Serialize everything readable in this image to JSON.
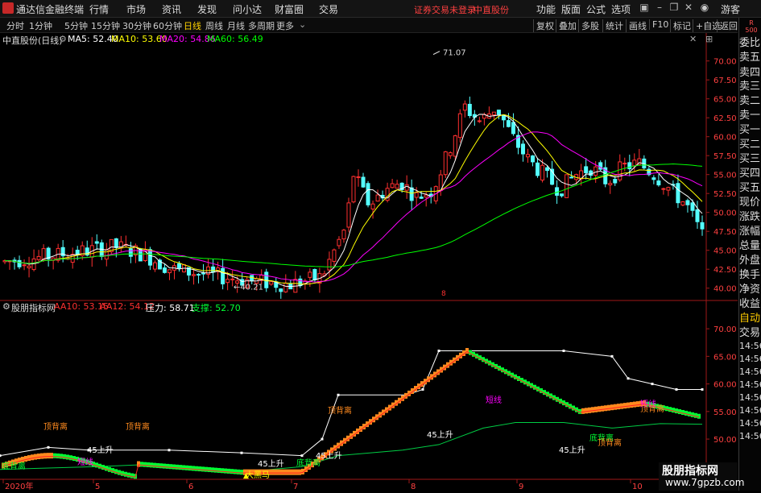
{
  "app": {
    "title": "通达信金融终端",
    "notice": "证券交易未登录",
    "stock_header": "中直股份",
    "guest": "游客"
  },
  "main_menu": [
    "行情",
    "市场",
    "资讯",
    "发现",
    "问小达",
    "财富圈",
    "交易"
  ],
  "right_menu": [
    "功能",
    "版面",
    "公式",
    "选项"
  ],
  "periods": [
    "分时",
    "1分钟",
    "5分钟",
    "15分钟",
    "30分钟",
    "60分钟",
    "日线",
    "周线",
    "月线",
    "多周期",
    "更多"
  ],
  "active_period": "日线",
  "tools": [
    "复权",
    "叠加",
    "多股",
    "统计",
    "画线",
    "F10",
    "标记",
    "+自选",
    "返回"
  ],
  "side_panel": {
    "badge": "R\n500",
    "items": [
      "委比",
      "卖五",
      "卖四",
      "卖三",
      "卖二",
      "卖一",
      "买一",
      "买二",
      "买三",
      "买四",
      "买五",
      "现价",
      "涨跌",
      "涨幅",
      "总量",
      "外盘",
      "换手",
      "净资",
      "收益",
      "自动",
      "交易",
      "14:56",
      "14:56",
      "14:56",
      "14:56",
      "14:56",
      "14:56",
      "14:56",
      "14:56"
    ]
  },
  "main_legend": {
    "stock": "中直股份(日线)",
    "ma5": "MA5: 52.40",
    "ma10": "MA10: 53.60",
    "ma20": "MA20: 54.86",
    "ma60": "MA60: 56.49"
  },
  "indicator_legend": {
    "name": "股朋指标网",
    "aa10": "AA10: 53.15",
    "aa12": "AA12: 54.12",
    "pressure": "压力: 58.71",
    "support": "支撑: 52.70"
  },
  "colors": {
    "up": "#ff3030",
    "down": "#54ffff",
    "ma5": "#ffffff",
    "ma10": "#ffff00",
    "ma20": "#ff00ff",
    "ma60": "#00ff00",
    "bull_bar": "#ff8a1e",
    "bear_bar": "#00ff33"
  },
  "annotations": {
    "high": "71.07",
    "low": "40.21",
    "mid_marker": "8"
  },
  "indicator_labels": [
    {
      "text": "底背离",
      "color": "#00ff33"
    },
    {
      "text": "顶背离",
      "color": "#ff8a1e"
    },
    {
      "text": "45上升",
      "color": "#ffffff"
    },
    {
      "text": "短线",
      "color": "#ff00ff"
    },
    {
      "text": "顶背离",
      "color": "#ff8a1e"
    },
    {
      "text": "45上升",
      "color": "#ffffff"
    },
    {
      "text": "大黑马",
      "color": "#ffff00"
    },
    {
      "text": "底背离",
      "color": "#00ff33"
    },
    {
      "text": "45上升",
      "color": "#ffffff"
    },
    {
      "text": "顶背离",
      "color": "#ff8a1e"
    },
    {
      "text": "45上升",
      "color": "#ffffff"
    },
    {
      "text": "短线",
      "color": "#ff00ff"
    },
    {
      "text": "45上升",
      "color": "#ffffff"
    },
    {
      "text": "底背离",
      "color": "#00ff33"
    },
    {
      "text": "顶背离",
      "color": "#ff8a1e"
    },
    {
      "text": "短线",
      "color": "#ff00ff"
    },
    {
      "text": "顶背离",
      "color": "#ff8a1e"
    }
  ],
  "x_axis": [
    "2020年",
    "5",
    "6",
    "7",
    "8",
    "9",
    "10"
  ],
  "watermark": {
    "line1": "股朋指标网",
    "line2": "www.7gpzb.com"
  },
  "chart_data": [
    {
      "type": "candlestick",
      "title": "中直股份(日线)",
      "y_ticks": [
        40.0,
        42.5,
        45.0,
        47.5,
        50.0,
        52.5,
        55.0,
        57.5,
        60.0,
        62.5,
        65.0,
        67.5,
        70.0
      ],
      "ylim": [
        38.8,
        72.2
      ],
      "x_labels": [
        "2020年",
        "5",
        "6",
        "7",
        "8",
        "9",
        "10"
      ],
      "series": [
        {
          "name": "MA5",
          "last": 52.4
        },
        {
          "name": "MA10",
          "last": 53.6
        },
        {
          "name": "MA20",
          "last": 54.86
        },
        {
          "name": "MA60",
          "last": 56.49
        }
      ],
      "high_label": 71.07,
      "low_label": 40.21
    },
    {
      "type": "line",
      "title": "股朋指标网",
      "y_ticks": [
        45.0,
        50.0,
        55.0,
        60.0,
        65.0,
        70.0
      ],
      "ylim": [
        43.0,
        72.5
      ],
      "series": [
        {
          "name": "AA10",
          "last": 53.15
        },
        {
          "name": "AA12",
          "last": 54.12
        },
        {
          "name": "压力",
          "last": 58.71
        },
        {
          "name": "支撑",
          "last": 52.7
        }
      ]
    }
  ]
}
